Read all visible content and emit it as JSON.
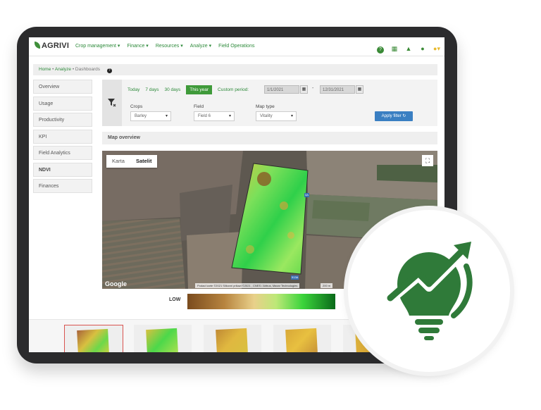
{
  "app": {
    "logo_text": "AGRIVI"
  },
  "nav": {
    "menu": [
      "Crop management ▾",
      "Finance ▾",
      "Resources ▾",
      "Analyze ▾",
      "Field Operations"
    ],
    "icons": [
      "help-icon",
      "calendar-icon",
      "bell-icon",
      "chat-icon",
      "user-avatar"
    ]
  },
  "breadcrumb": {
    "items": [
      "Home",
      "Analyze",
      "Dashboards"
    ],
    "sep": "•"
  },
  "sidebar": {
    "items": [
      "Overview",
      "Usage",
      "Productivity",
      "KPI",
      "Field Analytics",
      "NDVI",
      "Finances"
    ],
    "active": "NDVI"
  },
  "filter": {
    "periods": [
      "Today",
      "7 days",
      "30 days",
      "This year",
      "Custom period:"
    ],
    "selected_period": "This year",
    "date_from": "1/1/2021",
    "date_to": "12/31/2021",
    "date_sep": "-",
    "crops_label": "Crops",
    "crops_value": "Barley",
    "field_label": "Field",
    "field_value": "Field 6",
    "maptype_label": "Map type",
    "maptype_value": "Vitality",
    "apply_label": "Apply filter ↻"
  },
  "map": {
    "section_title": "Map overview",
    "toggle": [
      "Karta",
      "Satelit"
    ],
    "active_toggle": "Satelit",
    "google": "Google",
    "attribution": "Podaci karte ©2021 Slikovni prikazi ©2021 , CNES / Airbus, Maxar Technologies",
    "scale": "200 m",
    "road_labels": [
      "3A",
      "513A"
    ]
  },
  "legend": {
    "low_label": "LOW"
  },
  "colors": {
    "brand_green": "#3f9a3a",
    "apply_blue": "#3a7fc2",
    "badge_green": "#2f7a39"
  }
}
